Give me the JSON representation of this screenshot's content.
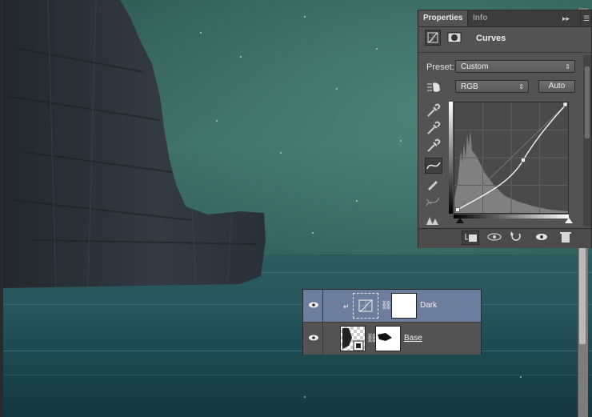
{
  "properties_panel": {
    "tabs": [
      "Properties",
      "Info"
    ],
    "title": "Curves",
    "preset_label": "Preset:",
    "preset_value": "Custom",
    "channel_value": "RGB",
    "auto_label": "Auto"
  },
  "layers": [
    {
      "name": "Dark",
      "selected": true
    },
    {
      "name": "Base",
      "selected": false
    }
  ]
}
